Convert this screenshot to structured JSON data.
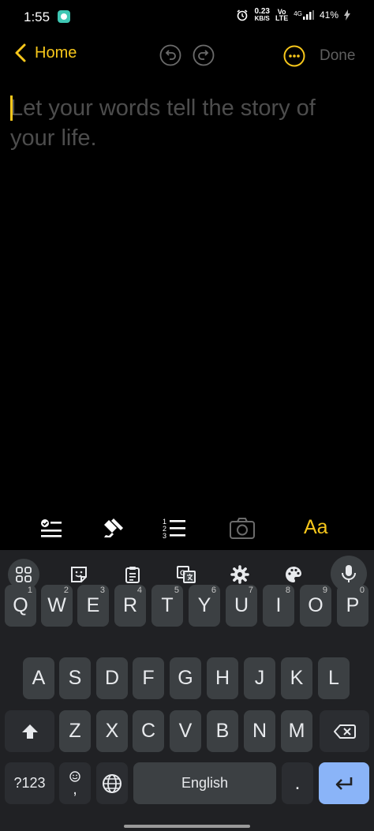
{
  "status": {
    "time": "1:55",
    "speed_value": "0.23",
    "speed_unit": "KB/S",
    "volte_top": "Vo",
    "volte_bottom": "LTE",
    "network": "4G",
    "battery": "41%"
  },
  "nav": {
    "back_label": "Home",
    "done_label": "Done"
  },
  "editor": {
    "placeholder": "Let your words tell the story of your life."
  },
  "format_toolbar": {
    "text_style_label": "Aa"
  },
  "keyboard": {
    "row1": [
      {
        "label": "Q",
        "hint": "1"
      },
      {
        "label": "W",
        "hint": "2"
      },
      {
        "label": "E",
        "hint": "3"
      },
      {
        "label": "R",
        "hint": "4"
      },
      {
        "label": "T",
        "hint": "5"
      },
      {
        "label": "Y",
        "hint": "6"
      },
      {
        "label": "U",
        "hint": "7"
      },
      {
        "label": "I",
        "hint": "8"
      },
      {
        "label": "O",
        "hint": "9"
      },
      {
        "label": "P",
        "hint": "0"
      }
    ],
    "row2": [
      "A",
      "S",
      "D",
      "F",
      "G",
      "H",
      "J",
      "K",
      "L"
    ],
    "row3": [
      "Z",
      "X",
      "C",
      "V",
      "B",
      "N",
      "M"
    ],
    "symbols_label": "?123",
    "comma_label": ",",
    "space_label": "English",
    "period_label": "."
  },
  "colors": {
    "accent": "#f7c71b",
    "keyboard_bg": "#202124",
    "key_bg": "#3c4043",
    "enter_bg": "#8ab4f8"
  }
}
